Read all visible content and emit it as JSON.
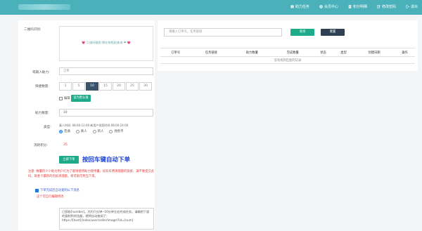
{
  "nav": [
    {
      "icon": "dollar-icon",
      "label": "助力任务"
    },
    {
      "icon": "user-icon",
      "label": "会员中心"
    },
    {
      "icon": "document-icon",
      "label": "积分明细"
    },
    {
      "icon": "edit-icon",
      "label": "修改密码"
    },
    {
      "icon": "logout-icon",
      "label": "退出"
    }
  ],
  "form": {
    "qr_label": "二维码识别:",
    "qr_hint": "💗 二维码截图 揭在按框粘查询 ❤ 💗",
    "order_label": "或输入助力:",
    "order_placeholder": "订单",
    "quick_qty_label": "快捷数量:",
    "qty_options": [
      "1",
      "5",
      "10",
      "15",
      "20",
      "25",
      "30"
    ],
    "qty_active": "10",
    "edit_label": "编辑",
    "set_default_label": "设为默认值",
    "assist_qty_label": "助力数量:",
    "assist_qty_value": "10",
    "type_label": "类型:",
    "type_note": "真人时间: 08:00-11:00 新用户领奖时间:08:00-24:00",
    "type_options": [
      "普通",
      "真人",
      "新人",
      "佣金币"
    ],
    "type_selected": "普通",
    "points_label": "消耗积分:",
    "points_value": "35",
    "submit_label": "立即下单",
    "big_title": "按回车键自动下单",
    "warning": "注意: 数量的少少助力用户们为了能够使用助力使用量，如有有费清理题的链接，满不要提交此码，助查卡最新的到此清理题，将可助可用当下来。",
    "auto_copy_label": "下单完成后自动复制以下消息",
    "auto_copy_note": "这个可自行编辑修改",
    "message": "已获取[number]。大约只分钟--10分钟左右完成任务，请确把下面的复制到浏览器，就将自动查阅了：https://[host]/index/user/order/image/?id=[num]"
  },
  "search": {
    "placeholder": "请输入订单号，任务链接",
    "search_label": "查询",
    "reset_label": "重置"
  },
  "table": {
    "headers": [
      "订单号",
      "任务链接",
      "助力数量",
      "完成数量",
      "状态",
      "类型",
      "创建日期",
      "操作"
    ],
    "empty_text": "没有找到匹配的记录"
  },
  "colors": {
    "topbar": "#4ab1ba",
    "accent_green": "#1dab89",
    "dark": "#2f4054",
    "warning": "#e23c3c",
    "title_blue": "#1a3fcf"
  }
}
